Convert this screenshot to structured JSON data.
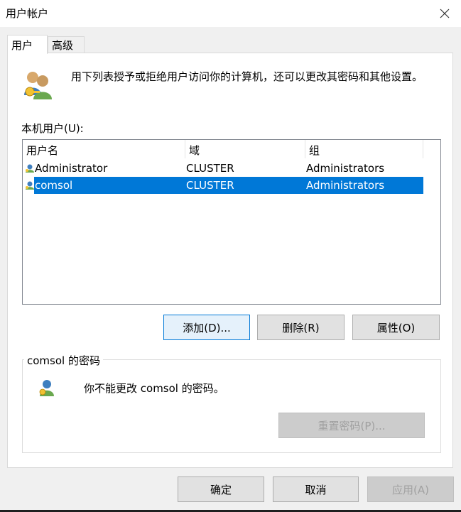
{
  "window": {
    "title": "用户帐户"
  },
  "tabs": [
    {
      "label": "用户"
    },
    {
      "label": "高级"
    }
  ],
  "description": "用下列表授予或拒绝用户访问你的计算机，还可以更改其密码和其他设置。",
  "local_users_label": "本机用户(U):",
  "table": {
    "columns": [
      "用户名",
      "域",
      "组"
    ],
    "rows": [
      {
        "name": "Administrator",
        "domain": "CLUSTER",
        "group": "Administrators",
        "selected": false
      },
      {
        "name": "comsol",
        "domain": "CLUSTER",
        "group": "Administrators",
        "selected": true
      }
    ]
  },
  "buttons": {
    "add": "添加(D)...",
    "remove": "删除(R)",
    "properties": "属性(O)",
    "reset_password": "重置密码(P)...",
    "ok": "确定",
    "cancel": "取消",
    "apply": "应用(A)"
  },
  "password_group": {
    "legend": "comsol 的密码",
    "message": "你不能更改 comsol 的密码。"
  },
  "colors": {
    "selection": "#0078d7",
    "focus_border": "#0078d7",
    "disabled_text": "#a0a0a0"
  }
}
